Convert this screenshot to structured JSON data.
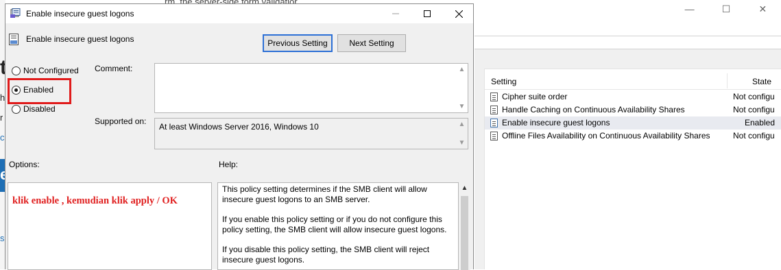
{
  "background": {
    "top_strip_text": "rm, the server-side form validatior",
    "left_fragments": [
      "t",
      "h",
      "r",
      "c",
      "e",
      "s"
    ],
    "list": {
      "col_setting": "Setting",
      "col_state": "State",
      "rows": [
        {
          "name": "Cipher suite order",
          "state": "Not configu",
          "selected": false
        },
        {
          "name": "Handle Caching on Continuous Availability Shares",
          "state": "Not configu",
          "selected": false
        },
        {
          "name": "Enable insecure guest logons",
          "state": "Enabled",
          "selected": true
        },
        {
          "name": "Offline Files Availability on Continuous Availability Shares",
          "state": "Not configu",
          "selected": false
        }
      ]
    },
    "caption_controls": [
      "—",
      "☐",
      "✕"
    ]
  },
  "dialog": {
    "title": "Enable insecure guest logons",
    "controls": {
      "minimize": "—",
      "maximize": "☐",
      "close": "✕"
    },
    "header_title": "Enable insecure guest logons",
    "prev_button": "Previous Setting",
    "next_button": "Next Setting",
    "radios": {
      "not_configured": "Not Configured",
      "enabled": "Enabled",
      "disabled": "Disabled",
      "selected": "enabled"
    },
    "comment_label": "Comment:",
    "comment_value": "",
    "supported_label": "Supported on:",
    "supported_value": "At least Windows Server 2016, Windows 10",
    "options_label": "Options:",
    "help_label": "Help:",
    "annotation": "klik enable , kemudian klik apply / OK",
    "help_paragraphs": [
      "This policy setting determines if the SMB client will allow insecure guest logons to an SMB server.",
      "If you enable this policy setting or if you do not configure this policy setting, the SMB client will allow insecure guest logons.",
      "If you disable this policy setting, the SMB client will reject insecure guest logons."
    ],
    "highlight_color": "#e01b1b",
    "annotation_color": "#e02020",
    "accent_color": "#2b6fd6"
  }
}
